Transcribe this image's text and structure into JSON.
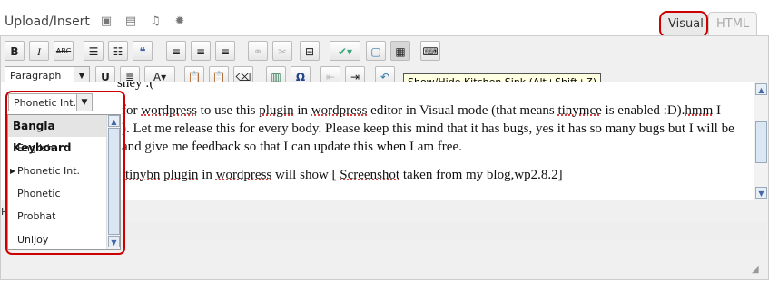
{
  "top": {
    "upload_label": "Upload/Insert",
    "media_icons": [
      "image-icon",
      "video-icon",
      "audio-icon",
      "media-icon"
    ],
    "tabs": {
      "visual": "Visual",
      "html": "HTML"
    }
  },
  "toolbar1": {
    "bold": "B",
    "italic": "I",
    "strikethrough": "ABC",
    "bullet_list": "≡",
    "numbered_list": "≡",
    "blockquote": "“"
  },
  "toolbar2": {
    "format_select": "Paragraph",
    "underline": "U",
    "text_color": "A",
    "special_char": "Ω"
  },
  "tooltip": "Show/Hide Kitchen Sink (Alt+Shift+Z)",
  "keyboard_select": {
    "value": "Phonetic Int.",
    "menu_header": "Bangla Keyboard",
    "options": [
      "English",
      "Phonetic Int.",
      "Phonetic",
      "Probhat",
      "Unijoy"
    ],
    "selected_index": 1
  },
  "content": {
    "line1": "sney :(",
    "line2_a": "for ",
    "line2_b": "wordpress",
    "line2_c": " to use this ",
    "line2_d": "plugin",
    "line2_e": " in ",
    "line2_f": "wordpress",
    "line2_g": " editor in Visual mode (that means ",
    "line2_h": "tinymce",
    "line2_i": " is enabled :D).",
    "line2_j": "hmm",
    "line2_k": " I",
    "line3": "). Let me release this for every body. Please keep this mind that it has bugs, yes it has so many bugs but I will be",
    "line4": "and give me feedback so that I can update this when I am free.",
    "line5_a": "tinybn",
    "line5_b": " ",
    "line5_c": "plugin",
    "line5_d": " in ",
    "line5_e": "wordpress",
    "line5_f": " will show [ ",
    "line5_g": "Screenshot",
    "line5_h": " taken from my blog,wp2.8.2]"
  },
  "path_label": "Path: p",
  "colors": {
    "highlight": "#cc0000",
    "tooltip_bg": "#ffffe1"
  }
}
